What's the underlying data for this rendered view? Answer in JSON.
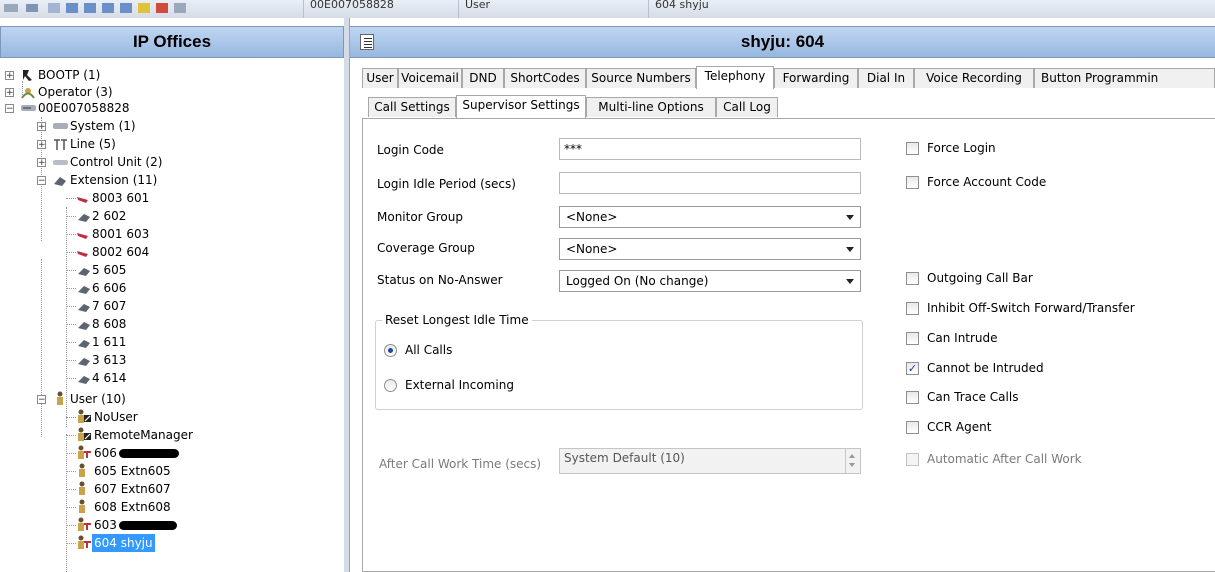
{
  "toolbar": {
    "cells": [
      "00E007058828",
      "User",
      "604 shyju"
    ]
  },
  "left_panel": {
    "title": "IP Offices",
    "tree": {
      "bootp": "BOOTP (1)",
      "operator": "Operator (3)",
      "system_node": "00E007058828",
      "system": "System (1)",
      "line": "Line (5)",
      "control_unit": "Control Unit (2)",
      "extension": "Extension (11)",
      "extensions": [
        "8003 601",
        "2 602",
        "8001 603",
        "8002 604",
        "5 605",
        "6 606",
        "7 607",
        "8 608",
        "1 611",
        "3 613",
        "4 614"
      ],
      "user": "User (10)",
      "users": [
        "NoUser",
        "RemoteManager",
        "606",
        "605 Extn605",
        "607 Extn607",
        "608 Extn608",
        "603",
        "604 shyju"
      ]
    }
  },
  "right_panel": {
    "title": "shyju: 604",
    "tabs": [
      "User",
      "Voicemail",
      "DND",
      "ShortCodes",
      "Source Numbers",
      "Telephony",
      "Forwarding",
      "Dial In",
      "Voice Recording",
      "Button Programmin"
    ],
    "active_tab": "Telephony",
    "subtabs": [
      "Call Settings",
      "Supervisor Settings",
      "Multi-line Options",
      "Call Log"
    ],
    "active_subtab": "Supervisor Settings",
    "form": {
      "login_code_label": "Login Code",
      "login_code_value": "***",
      "login_idle_label": "Login Idle Period (secs)",
      "login_idle_value": "",
      "monitor_group_label": "Monitor Group",
      "monitor_group_value": "<None>",
      "coverage_group_label": "Coverage Group",
      "coverage_group_value": "<None>",
      "status_no_answer_label": "Status on No-Answer",
      "status_no_answer_value": "Logged On (No change)",
      "reset_group_title": "Reset Longest Idle Time",
      "radio_all_calls": "All Calls",
      "radio_external": "External Incoming",
      "radio_selected": "All Calls",
      "after_call_label": "After Call Work Time (secs)",
      "after_call_value": "System Default (10)"
    },
    "checkboxes": [
      {
        "label": "Force Login",
        "checked": false,
        "enabled": true
      },
      {
        "label": "Force Account Code",
        "checked": false,
        "enabled": true
      },
      {
        "label": "Outgoing Call Bar",
        "checked": false,
        "enabled": true
      },
      {
        "label": "Inhibit Off-Switch Forward/Transfer",
        "checked": false,
        "enabled": true
      },
      {
        "label": "Can Intrude",
        "checked": false,
        "enabled": true
      },
      {
        "label": "Cannot be Intruded",
        "checked": true,
        "enabled": true
      },
      {
        "label": "Can Trace Calls",
        "checked": false,
        "enabled": true
      },
      {
        "label": "CCR Agent",
        "checked": false,
        "enabled": true
      },
      {
        "label": "Automatic After Call Work",
        "checked": false,
        "enabled": false
      }
    ]
  },
  "colors": {
    "header_gradient_top": "#bfd6f2",
    "header_gradient_bottom": "#98b7df",
    "selection": "#3399ff",
    "redaction": "#000000"
  }
}
